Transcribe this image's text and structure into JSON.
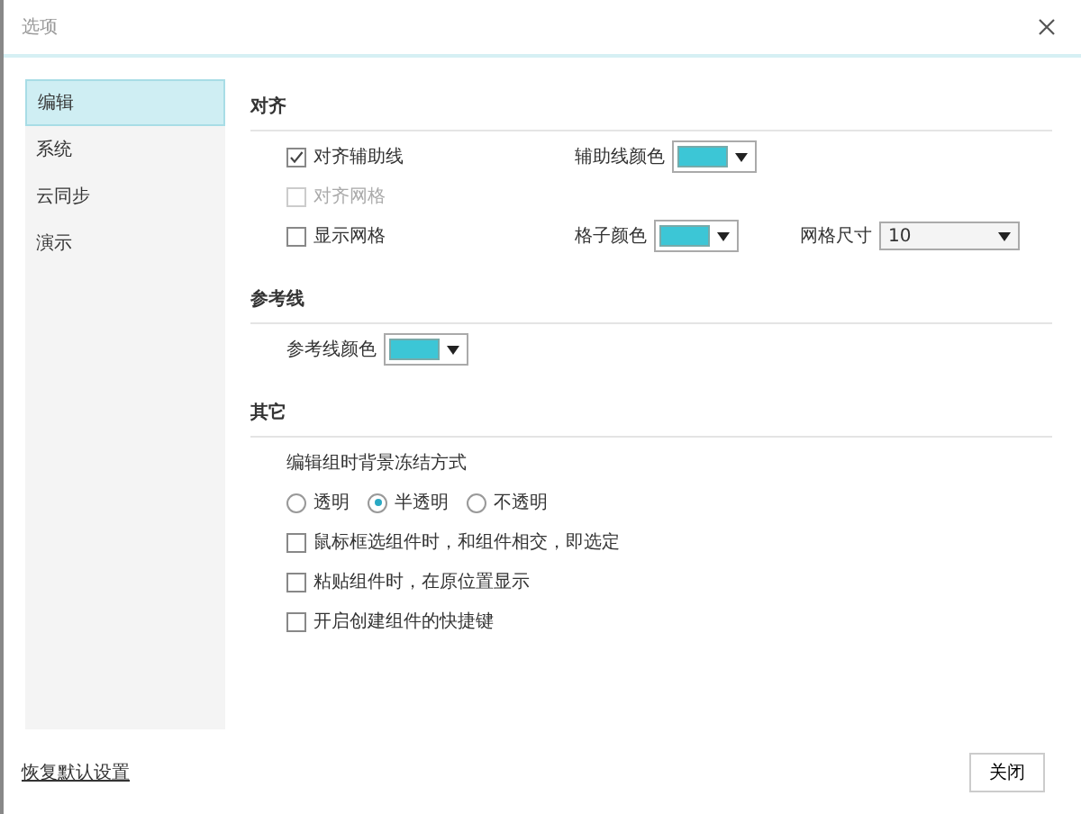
{
  "window": {
    "title": "选项"
  },
  "sidebar": {
    "items": [
      {
        "label": "编辑",
        "selected": true
      },
      {
        "label": "系统",
        "selected": false
      },
      {
        "label": "云同步",
        "selected": false
      },
      {
        "label": "演示",
        "selected": false
      }
    ]
  },
  "sections": [
    {
      "title": "对齐",
      "rows": [
        [
          {
            "kind": "checkbox",
            "label": "对齐辅助线",
            "checked": true,
            "disabled": false
          },
          {
            "kind": "color",
            "label": "辅助线颜色",
            "color": "#3cc6d6"
          }
        ],
        [
          {
            "kind": "checkbox",
            "label": "对齐网格",
            "checked": false,
            "disabled": true
          }
        ],
        [
          {
            "kind": "checkbox",
            "label": "显示网格",
            "checked": false,
            "disabled": false
          },
          {
            "kind": "color",
            "label": "格子颜色",
            "color": "#3cc6d6"
          },
          {
            "kind": "select",
            "label": "网格尺寸",
            "value": "10"
          }
        ]
      ]
    },
    {
      "title": "参考线",
      "rows": [
        [
          {
            "kind": "color",
            "label": "参考线颜色",
            "color": "#3cc6d6"
          }
        ]
      ]
    },
    {
      "title": "其它",
      "rows": [
        [
          {
            "kind": "text",
            "label": "编辑组时背景冻结方式"
          }
        ],
        [
          {
            "kind": "radio",
            "label": "透明",
            "selected": false
          },
          {
            "kind": "radio",
            "label": "半透明",
            "selected": true
          },
          {
            "kind": "radio",
            "label": "不透明",
            "selected": false
          }
        ],
        [
          {
            "kind": "checkbox",
            "label": "鼠标框选组件时，和组件相交，即选定",
            "checked": false,
            "disabled": false
          }
        ],
        [
          {
            "kind": "checkbox",
            "label": "粘贴组件时，在原位置显示",
            "checked": false,
            "disabled": false
          }
        ],
        [
          {
            "kind": "checkbox",
            "label": "开启创建组件的快捷键",
            "checked": false,
            "disabled": false
          }
        ]
      ]
    }
  ],
  "footer": {
    "reset_link": "恢复默认设置",
    "close_button": "关闭"
  }
}
